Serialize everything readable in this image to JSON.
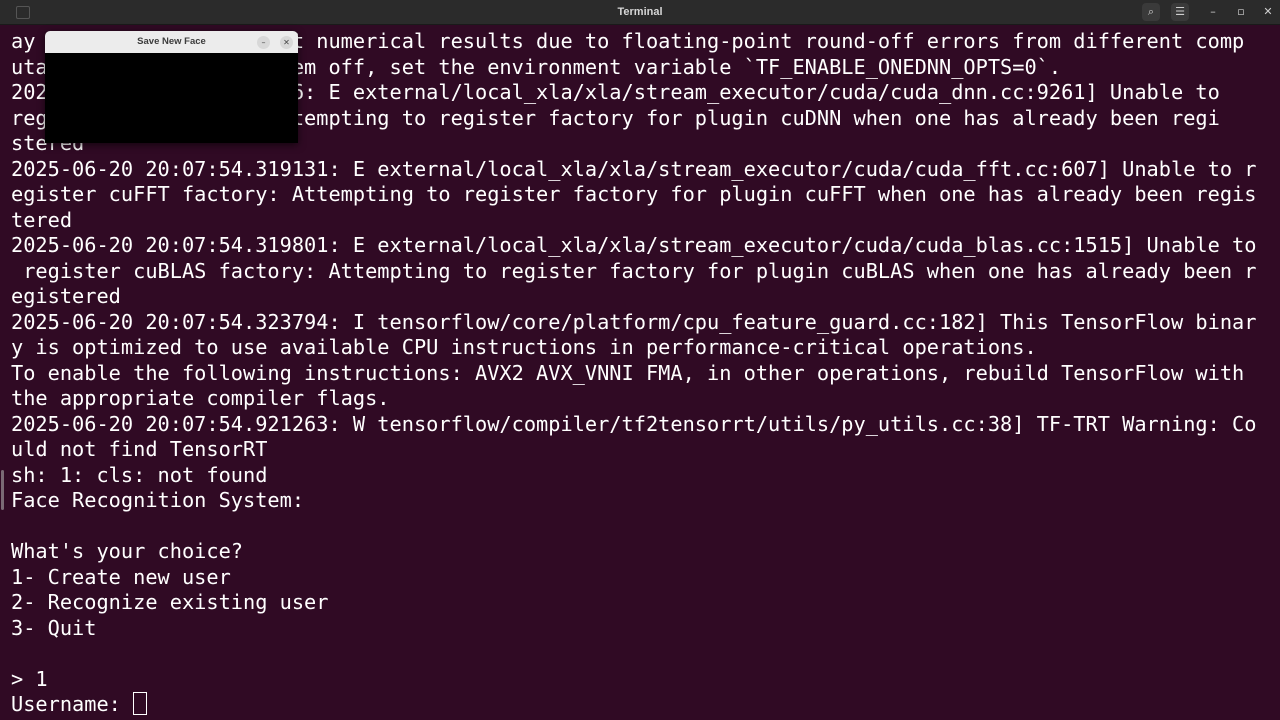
{
  "window": {
    "title": "Terminal",
    "icons": {
      "left": "terminal-tab-icon",
      "search": "search-icon",
      "menu": "hamburger-menu-icon",
      "minimize": "minimize-icon",
      "maximize": "maximize-icon",
      "close": "close-icon"
    },
    "glyphs": {
      "search": "⌕",
      "menu": "☰",
      "minimize": "–",
      "maximize": "▫",
      "close": "✕"
    }
  },
  "popup": {
    "title": "Save New Face",
    "minimize_glyph": "–",
    "close_glyph": "✕"
  },
  "terminal": {
    "lines": [
      "ay                    nt numerical results due to floating-point round-off errors from different comp",
      "uta                  them off, set the environment variable `TF_ENABLE_ONEDNN_OPTS=0`.",
      "202                  096: E external/local_xla/xla/stream_executor/cuda/cuda_dnn.cc:9261] Unable to",
      "reg                  Attempting to register factory for plugin cuDNN when one has already been regi",
      "stered",
      "2025-06-20 20:07:54.319131: E external/local_xla/xla/stream_executor/cuda/cuda_fft.cc:607] Unable to r",
      "egister cuFFT factory: Attempting to register factory for plugin cuFFT when one has already been regis",
      "tered",
      "2025-06-20 20:07:54.319801: E external/local_xla/xla/stream_executor/cuda/cuda_blas.cc:1515] Unable to",
      " register cuBLAS factory: Attempting to register factory for plugin cuBLAS when one has already been r",
      "egistered",
      "2025-06-20 20:07:54.323794: I tensorflow/core/platform/cpu_feature_guard.cc:182] This TensorFlow binar",
      "y is optimized to use available CPU instructions in performance-critical operations.",
      "To enable the following instructions: AVX2 AVX_VNNI FMA, in other operations, rebuild TensorFlow with",
      "the appropriate compiler flags.",
      "2025-06-20 20:07:54.921263: W tensorflow/compiler/tf2tensorrt/utils/py_utils.cc:38] TF-TRT Warning: Co",
      "uld not find TensorRT",
      "sh: 1: cls: not found",
      "Face Recognition System:",
      "",
      "What's your choice?",
      "1- Create new user",
      "2- Recognize existing user",
      "3- Quit",
      "",
      "> 1"
    ],
    "prompt": "Username: ",
    "input_value": ""
  },
  "colors": {
    "background": "#300a24",
    "foreground": "#ffffff",
    "titlebar": "#2b2b2b",
    "popup_titlebar": "#ececec"
  }
}
